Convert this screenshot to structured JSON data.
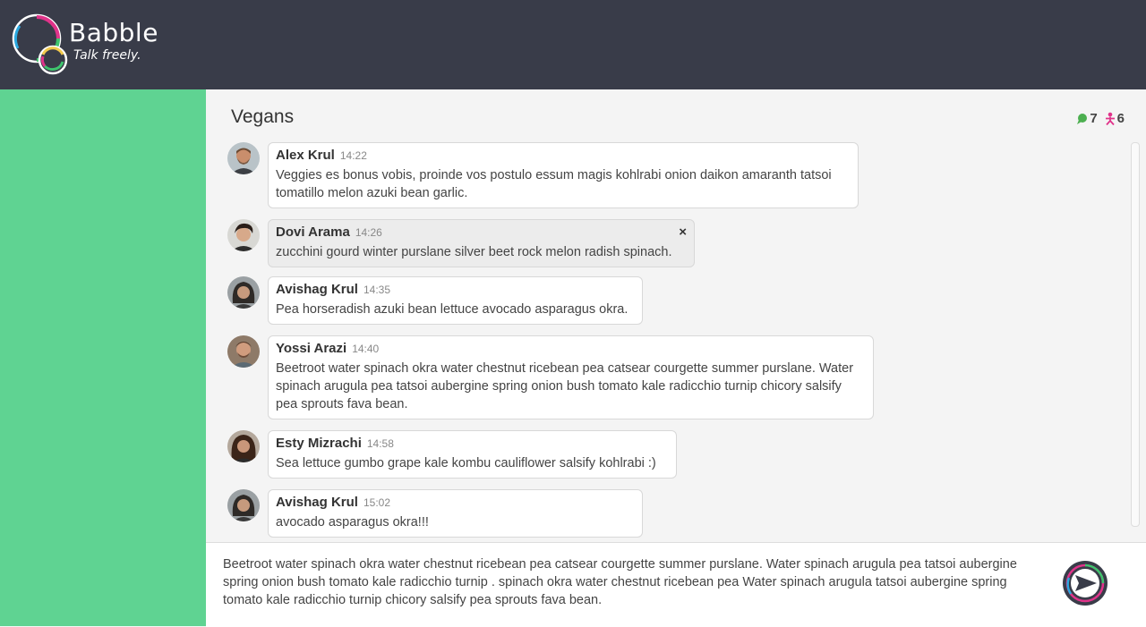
{
  "app": {
    "name": "Babble",
    "tagline": "Talk freely."
  },
  "room": {
    "title": "Vegans",
    "messages_count": "7",
    "members_count": "6"
  },
  "colors": {
    "header": "#393c49",
    "sidebar": "#5fd392",
    "chat_icon": "#4caf50",
    "member_icon": "#e0338a"
  },
  "messages": [
    {
      "author": "Alex Krul",
      "time": "14:22",
      "text": "Veggies es bonus vobis, proinde vos postulo essum magis kohlrabi onion daikon amaranth tatsoi tomatillo melon azuki bean garlic."
    },
    {
      "author": "Dovi Arama",
      "time": "14:26",
      "text": "zucchini gourd winter purslane silver beet rock melon radish spinach.",
      "close": "×"
    },
    {
      "author": "Avishag Krul",
      "time": "14:35",
      "text": "Pea horseradish azuki bean lettuce avocado asparagus okra."
    },
    {
      "author": "Yossi Arazi",
      "time": "14:40",
      "text": "Beetroot water spinach okra water chestnut ricebean pea catsear courgette summer purslane. Water spinach arugula pea tatsoi aubergine spring onion bush tomato kale radicchio turnip chicory salsify pea sprouts fava bean."
    },
    {
      "author": "Esty Mizrachi",
      "time": "14:58",
      "text": "Sea lettuce gumbo grape kale kombu cauliflower salsify kohlrabi :)"
    },
    {
      "author": "Avishag Krul",
      "time": "15:02",
      "text": "avocado asparagus okra!!!"
    }
  ],
  "composer": {
    "text": "Beetroot water spinach okra water chestnut ricebean pea catsear courgette summer purslane. Water spinach arugula pea tatsoi aubergine spring onion bush tomato kale radicchio turnip . spinach okra water chestnut ricebean pea  Water spinach arugula tatsoi aubergine spring  tomato kale radicchio turnip chicory salsify pea sprouts fava bean."
  }
}
